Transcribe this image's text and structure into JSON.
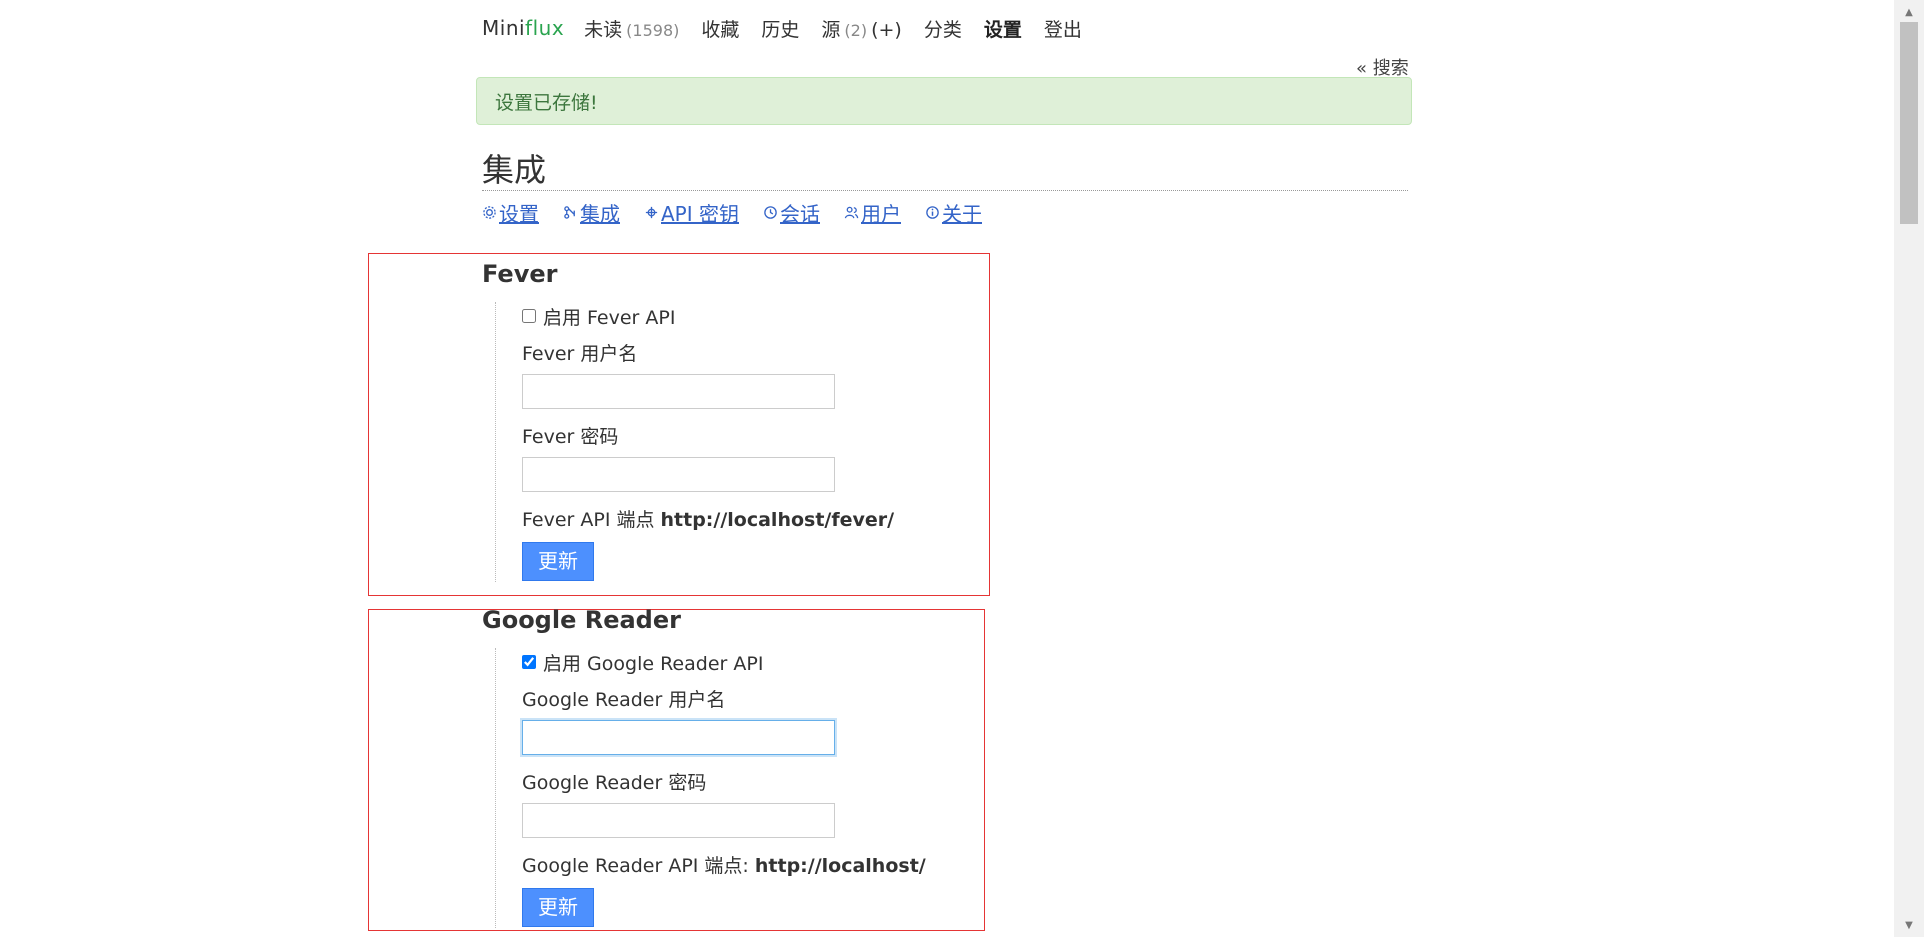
{
  "nav": {
    "logo_mini": "Mini",
    "logo_flux": "flux",
    "unread_label": "未读",
    "unread_count": "(1598)",
    "starred_label": "收藏",
    "history_label": "历史",
    "feeds_label": "源",
    "feeds_count": "(2)",
    "feeds_add": "(+)",
    "categories_label": "分类",
    "settings_label": "设置",
    "logout_label": "登出",
    "search_link": "« 搜索"
  },
  "flash": {
    "message": "设置已存储!"
  },
  "page": {
    "title": "集成"
  },
  "submenu": {
    "items": [
      {
        "icon": "gear-icon",
        "label": "设置"
      },
      {
        "icon": "integration-icon",
        "label": "集成"
      },
      {
        "icon": "api-key-icon",
        "label": "API 密钥"
      },
      {
        "icon": "history-icon",
        "label": "会话"
      },
      {
        "icon": "users-icon",
        "label": "用户"
      },
      {
        "icon": "info-icon",
        "label": "关于"
      }
    ]
  },
  "fever": {
    "title": "Fever",
    "enable_label": "启用 Fever API",
    "enabled": false,
    "username_label": "Fever 用户名",
    "username_value": "",
    "password_label": "Fever 密码",
    "password_value": "",
    "endpoint_label": "Fever API 端点",
    "endpoint_url": "http://localhost/fever/",
    "update_button": "更新"
  },
  "google_reader": {
    "title": "Google Reader",
    "enable_label": "启用 Google Reader API",
    "enabled": true,
    "username_label": "Google Reader 用户名",
    "username_value": "",
    "password_label": "Google Reader 密码",
    "password_value": "",
    "endpoint_label": "Google Reader API 端点:",
    "endpoint_url": "http://localhost/",
    "update_button": "更新"
  },
  "colors": {
    "link": "#3464c8",
    "logo_accent": "#2aa44f",
    "flash_bg": "#dff0d8",
    "flash_text": "#3c763d",
    "button_bg": "#4d90fe",
    "highlight_border": "#e53535"
  }
}
